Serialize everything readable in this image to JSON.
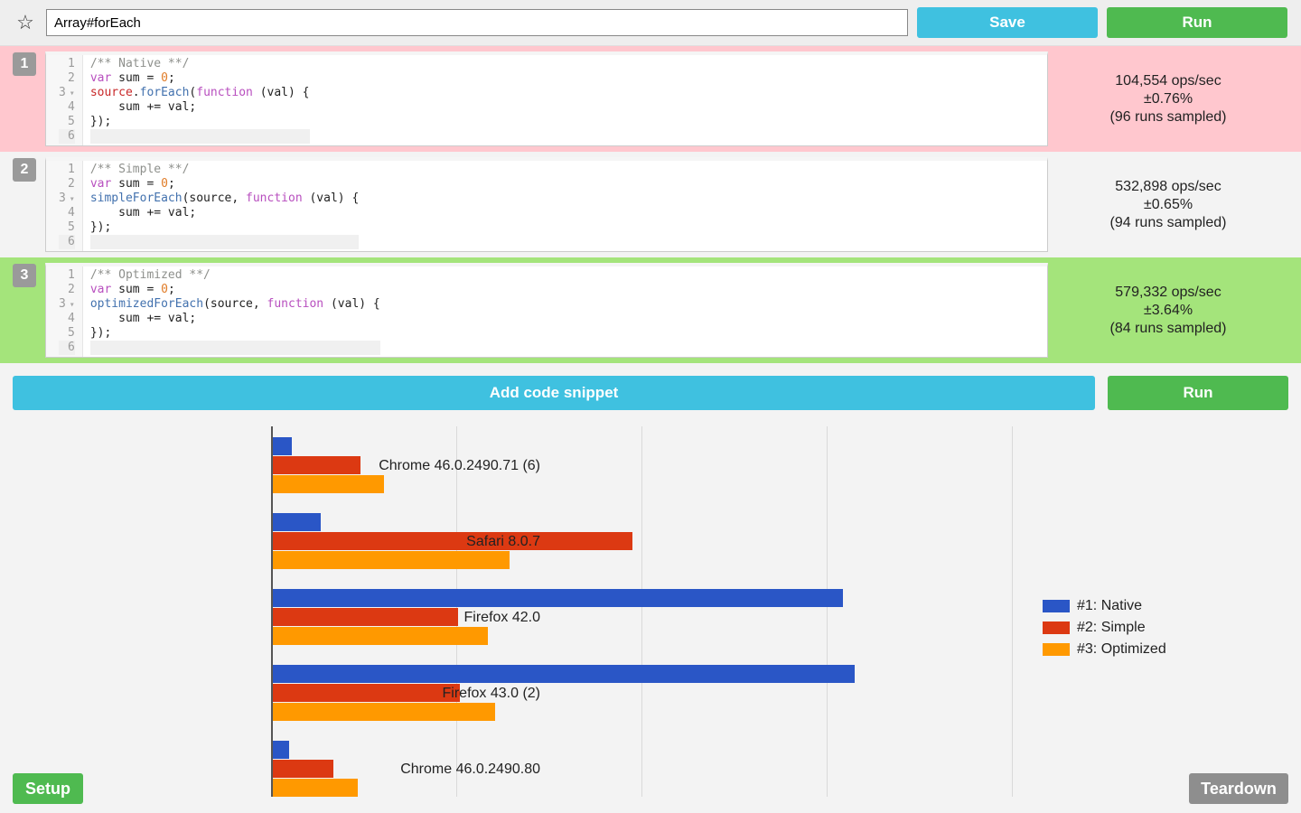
{
  "header": {
    "title_value": "Array#forEach",
    "save_label": "Save",
    "run_label": "Run"
  },
  "snippets": [
    {
      "num": "1",
      "bg": "pink",
      "code_html": "<span class='cm'>/** Native **/</span>\n<span class='kw'>var</span> sum = <span class='num'>0</span>;\n<span class='id'>source</span>.<span class='fn'>forEach</span>(<span class='kw'>function</span> (val) {\n    sum += val;\n});",
      "ops": "104,554 ops/sec",
      "pm": "±0.76%",
      "runs": "(96 runs sampled)"
    },
    {
      "num": "2",
      "bg": "white",
      "code_html": "<span class='cm'>/** Simple **/</span>\n<span class='kw'>var</span> sum = <span class='num'>0</span>;\n<span class='fn'>simpleForEach</span>(source, <span class='kw'>function</span> (val) {\n    sum += val;\n});",
      "ops": "532,898 ops/sec",
      "pm": "±0.65%",
      "runs": "(94 runs sampled)"
    },
    {
      "num": "3",
      "bg": "green",
      "code_html": "<span class='cm'>/** Optimized **/</span>\n<span class='kw'>var</span> sum = <span class='num'>0</span>;\n<span class='fn'>optimizedForEach</span>(source, <span class='kw'>function</span> (val) {\n    sum += val;\n});",
      "ops": "579,332 ops/sec",
      "pm": "±3.64%",
      "runs": "(84 runs sampled)"
    }
  ],
  "mid": {
    "add_label": "Add code snippet",
    "run_label": "Run"
  },
  "bottom": {
    "setup_label": "Setup",
    "teardown_label": "Teardown"
  },
  "legend": {
    "s1": "#1: Native",
    "s2": "#2: Simple",
    "s3": "#3: Optimized"
  },
  "chart_data": {
    "type": "bar",
    "orientation": "horizontal",
    "categories": [
      "Chrome 46.0.2490.71 (6)",
      "Safari 8.0.7",
      "Firefox 42.0",
      "Firefox 43.0 (2)",
      "Chrome 46.0.2490.80"
    ],
    "series": [
      {
        "name": "#1: Native",
        "color": "#2a56c6",
        "values": [
          25000,
          65000,
          770000,
          785000,
          22000
        ]
      },
      {
        "name": "#2: Simple",
        "color": "#dc3912",
        "values": [
          118000,
          485000,
          250000,
          252000,
          82000
        ]
      },
      {
        "name": "#3: Optimized",
        "color": "#ff9900",
        "values": [
          150000,
          320000,
          290000,
          300000,
          115000
        ]
      }
    ],
    "xlim": [
      0,
      1000000
    ],
    "gridlines": [
      0,
      250000,
      500000,
      750000,
      1000000
    ]
  }
}
